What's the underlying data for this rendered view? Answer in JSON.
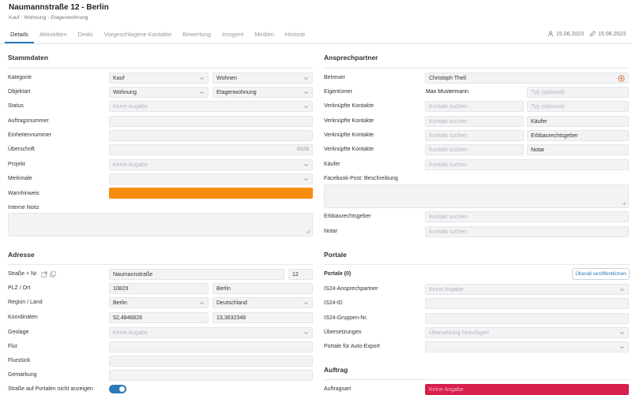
{
  "header": {
    "title": "Naumannstraße 12 - Berlin",
    "breadcrumb": [
      "Kauf",
      "Wohnung",
      "Etagenwohnung"
    ],
    "tabs": [
      "Details",
      "Aktivitäten",
      "Deals",
      "Vorgeschlagene Kontakte",
      "Bewertung",
      "Imogent",
      "Medien",
      "Historie"
    ],
    "active_tab": "Details",
    "created_date": "15.06.2023",
    "edited_date": "15.06.2023",
    "created_icon": "user-icon",
    "edited_icon": "pencil-icon"
  },
  "stammdaten": {
    "title": "Stammdaten",
    "kategorie": {
      "label": "Kategorie",
      "value1": "Kauf",
      "value2": "Wohnen"
    },
    "objektart": {
      "label": "Objektart",
      "value1": "Wohnung",
      "value2": "Etagenwohnung"
    },
    "status": {
      "label": "Status",
      "placeholder": "Keine Angabe"
    },
    "auftragsnummer": {
      "label": "Auftragsnummer",
      "value": ""
    },
    "einheitennummer": {
      "label": "Einheitennummer",
      "value": ""
    },
    "ueberschrift": {
      "label": "Überschrift",
      "counter": "0/100"
    },
    "projekt": {
      "label": "Projekt",
      "placeholder": "Keine Angabe"
    },
    "merkmale": {
      "label": "Merkmale",
      "value": ""
    },
    "warnhinweis": {
      "label": "Warnhinweis",
      "color": "#f78c0a"
    },
    "interne_notiz": {
      "label": "Interne Notiz",
      "value": ""
    }
  },
  "adresse": {
    "title": "Adresse",
    "strasse": {
      "label": "Straße + Nr.",
      "street": "Naumannstraße",
      "number": "12"
    },
    "plz_ort": {
      "label": "PLZ / Ort",
      "plz": "10829",
      "ort": "Berlin"
    },
    "region_land": {
      "label": "Region / Land",
      "region": "Berlin",
      "land": "Deutschland"
    },
    "koordinaten": {
      "label": "Koordinaten",
      "lat": "52,4846826",
      "lng": "13,3632348"
    },
    "geolage": {
      "label": "Geolage",
      "placeholder": "Keine Angabe"
    },
    "flur": {
      "label": "Flur",
      "value": ""
    },
    "flurstueck": {
      "label": "Flurstück",
      "value": ""
    },
    "gemarkung": {
      "label": "Gemarkung",
      "value": ""
    },
    "strasse_portale": {
      "label": "Straße auf Portalen nicht anzeigen",
      "enabled": true
    }
  },
  "ansprechpartner": {
    "title": "Ansprechpartner",
    "betreuer": {
      "label": "Betreuer",
      "value": "Christoph Theil"
    },
    "eigentuemer": {
      "label": "Eigentümer",
      "value": "Max Mustermann",
      "type_placeholder": "Typ (optional)"
    },
    "verknuepfte": [
      {
        "label": "Verknüpfte Kontakte",
        "placeholder": "Kontakt suchen",
        "type": "",
        "type_placeholder": "Typ (optional)"
      },
      {
        "label": "Verknüpfte Kontakte",
        "placeholder": "Kontakt suchen",
        "type": "Käufer",
        "type_placeholder": ""
      },
      {
        "label": "Verknüpfte Kontakte",
        "placeholder": "Kontakt suchen",
        "type": "Erbbaurechtsgeber",
        "type_placeholder": ""
      },
      {
        "label": "Verknüpfte Kontakte",
        "placeholder": "Kontakt suchen",
        "type": "Notar",
        "type_placeholder": ""
      }
    ],
    "kaeufer": {
      "label": "Käufer",
      "placeholder": "Kontakt suchen"
    },
    "facebook": {
      "label": "Facebook-Post: Beschreibung",
      "value": ""
    },
    "erbbaurechtsgeber": {
      "label": "Erbbaurechtsgeber",
      "placeholder": "Kontakt suchen"
    },
    "notar": {
      "label": "Notar",
      "placeholder": "Kontakt suchen"
    }
  },
  "portale": {
    "title": "Portale",
    "count_label": "Portale (0)",
    "publish_button": "Überall veröffentlichen",
    "is24_ansprechpartner": {
      "label": "IS24-Ansprechpartner",
      "placeholder": "Keine Angabe"
    },
    "is24_id": {
      "label": "IS24-ID",
      "value": ""
    },
    "is24_gruppen": {
      "label": "IS24-Gruppen-Nr.",
      "value": ""
    },
    "uebersetzungen": {
      "label": "Übersetzungen",
      "placeholder": "Übersetzung hinzufügen"
    },
    "auto_export": {
      "label": "Portale für Auto-Export",
      "value": ""
    }
  },
  "auftrag": {
    "title": "Auftrag",
    "auftragsart": {
      "label": "Auftragsart",
      "placeholder": "Keine Angabe",
      "color": "#d81e4b"
    }
  }
}
